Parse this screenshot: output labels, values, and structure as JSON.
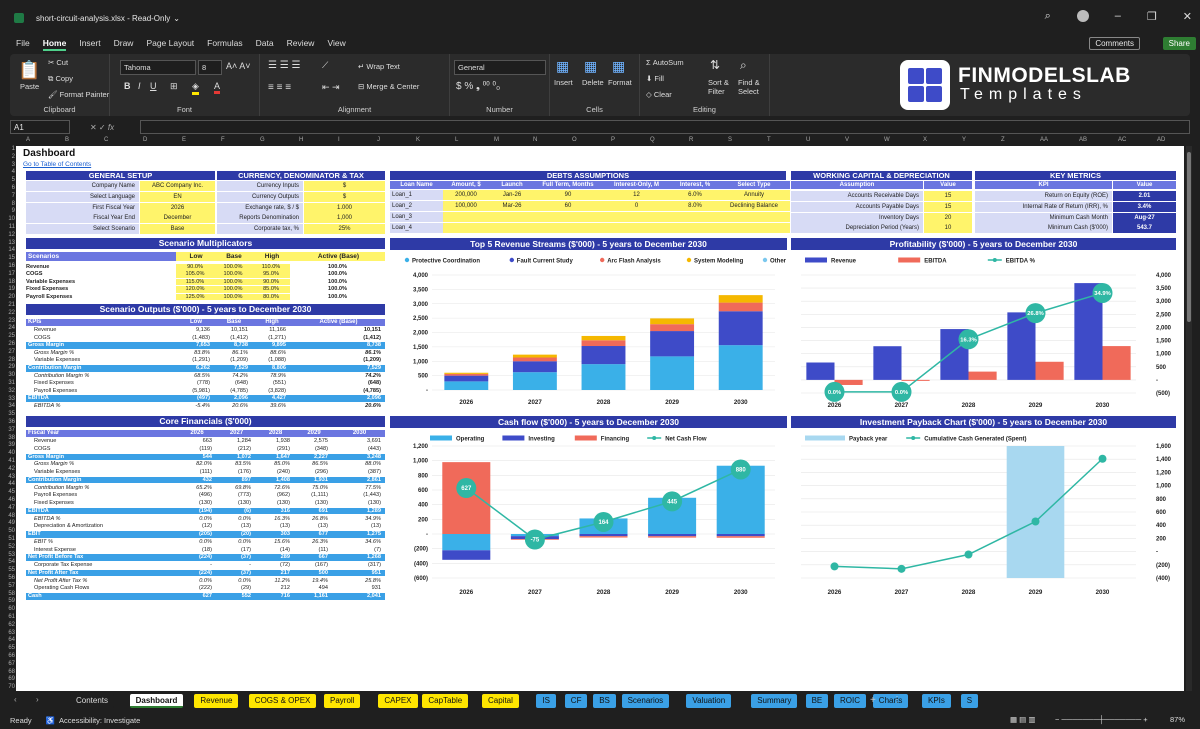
{
  "window": {
    "title": "short-circuit-analysis.xlsx - Read-Only",
    "chev": "⌄"
  },
  "menu": [
    "File",
    "Home",
    "Insert",
    "Draw",
    "Page Layout",
    "Formulas",
    "Data",
    "Review",
    "View"
  ],
  "menu_selected": "Home",
  "top_buttons": {
    "comments": "Comments",
    "share": "Share"
  },
  "ribbon": {
    "clipboard": {
      "paste": "Paste",
      "cut": "Cut",
      "copy": "Copy",
      "format_painter": "Format Painter",
      "label": "Clipboard"
    },
    "font": {
      "name": "Tahoma",
      "size": "8",
      "label": "Font"
    },
    "alignment": {
      "wrap": "Wrap Text",
      "merge": "Merge & Center",
      "label": "Alignment"
    },
    "number": {
      "format": "General",
      "label": "Number"
    },
    "cells": {
      "insert": "Insert",
      "delete": "Delete",
      "format": "Format",
      "label": "Cells"
    },
    "editing": {
      "autosum": "AutoSum",
      "fill": "Fill",
      "clear": "Clear",
      "sort": "Sort & Filter",
      "find": "Find & Select",
      "label": "Editing"
    }
  },
  "logo": {
    "line1": "FINMODELSLAB",
    "line2": "Templates"
  },
  "formula_bar": {
    "name_box": "A1",
    "fx": "fx"
  },
  "columns": [
    "A",
    "B",
    "C",
    "D",
    "E",
    "F",
    "G",
    "H",
    "I",
    "J",
    "K",
    "L",
    "M",
    "N",
    "O",
    "P",
    "Q",
    "R",
    "S",
    "T",
    "U",
    "V",
    "W",
    "X",
    "Y",
    "Z",
    "AA",
    "AB",
    "AC",
    "AD"
  ],
  "sheet": {
    "title": "Dashboard",
    "toc_link": "Go to Table of Contents",
    "general_setup": {
      "header": "GENERAL SETUP",
      "rows": [
        [
          "Company Name",
          "ABC Company Inc."
        ],
        [
          "Select Language",
          "EN"
        ],
        [
          "First Fiscal Year",
          "2026"
        ],
        [
          "Fiscal Year End",
          "December"
        ],
        [
          "Select Scenario",
          "Base"
        ]
      ]
    },
    "currency": {
      "header": "CURRENCY, DENOMINATOR & TAX",
      "rows": [
        [
          "Currency Inputs",
          "$"
        ],
        [
          "Currency Outputs",
          "$"
        ],
        [
          "Exchange rate, $ / $",
          "1.000"
        ],
        [
          "Reports Denomination",
          "1,000"
        ],
        [
          "Corporate tax, %",
          "25%"
        ]
      ]
    },
    "debts": {
      "header": "DEBTS ASSUMPTIONS",
      "cols": [
        "Loan Name",
        "Amount, $",
        "Launch",
        "Full Term, Months",
        "Interest-Only, M",
        "Interest, %",
        "Select Type"
      ],
      "rows": [
        [
          "Loan_1",
          "200,000",
          "Jan-26",
          "90",
          "12",
          "6.0%",
          "Annuity"
        ],
        [
          "Loan_2",
          "100,000",
          "Mar-26",
          "60",
          "0",
          "8.0%",
          "Declining Balance"
        ],
        [
          "Loan_3",
          "",
          "",
          "",
          "",
          "",
          ""
        ],
        [
          "Loan_4",
          "",
          "",
          "",
          "",
          "",
          ""
        ]
      ]
    },
    "wc": {
      "header": "WORKING CAPITAL & DEPRECIATION",
      "cols": [
        "Assumption",
        "Value"
      ],
      "rows": [
        [
          "Accounts Receivable Days",
          "15"
        ],
        [
          "Accounts Payable Days",
          "15"
        ],
        [
          "Inventory Days",
          "20"
        ],
        [
          "Depreciation Period (Years)",
          "10"
        ]
      ]
    },
    "kpi": {
      "header": "KEY METRICS",
      "cols": [
        "KPI",
        "Value"
      ],
      "rows": [
        [
          "Return on Equity (ROE)",
          "2.01"
        ],
        [
          "Internal Rate of Return (IRR), %",
          "3.4%"
        ],
        [
          "Minimum Cash Month",
          "Aug-27"
        ],
        [
          "Minimum Cash ($'000)",
          "543.7"
        ]
      ]
    },
    "scen_mult": {
      "title": "Scenario Multiplicators",
      "cols": [
        "Scenarios",
        "Low",
        "Base",
        "High",
        "Active (Base)"
      ],
      "rows": [
        [
          "Revenue",
          "90.0%",
          "100.0%",
          "110.0%",
          "100.0%"
        ],
        [
          "COGS",
          "105.0%",
          "100.0%",
          "95.0%",
          "100.0%"
        ],
        [
          "Variable Expenses",
          "115.0%",
          "100.0%",
          "90.0%",
          "100.0%"
        ],
        [
          "Fixed Expenses",
          "120.0%",
          "100.0%",
          "85.0%",
          "100.0%"
        ],
        [
          "Payroll Expenses",
          "125.0%",
          "100.0%",
          "80.0%",
          "100.0%"
        ]
      ]
    },
    "scen_out": {
      "title": "Scenario Outputs ($'000) - 5 years to December 2030",
      "cols": [
        "KPIs",
        "Low",
        "Base",
        "High",
        "Active (Base)"
      ],
      "rows": [
        [
          "Revenue",
          "9,136",
          "10,151",
          "11,166",
          "10,151",
          "n"
        ],
        [
          "COGS",
          "(1,483)",
          "(1,412)",
          "(1,271)",
          "(1,412)",
          "n"
        ],
        [
          "Gross Margin",
          "7,653",
          "8,738",
          "9,895",
          "8,738",
          "h"
        ],
        [
          "Gross Margin %",
          "83.8%",
          "86.1%",
          "88.6%",
          "86.1%",
          "i"
        ],
        [
          "Variable Expenses",
          "(1,291)",
          "(1,209)",
          "(1,088)",
          "(1,209)",
          "n"
        ],
        [
          "Contribution Margin",
          "6,262",
          "7,529",
          "8,806",
          "7,529",
          "h"
        ],
        [
          "Contribution Margin %",
          "68.5%",
          "74.2%",
          "78.9%",
          "74.2%",
          "i"
        ],
        [
          "Fixed Expenses",
          "(778)",
          "(648)",
          "(551)",
          "(648)",
          "n"
        ],
        [
          "Payroll Expenses",
          "(5,981)",
          "(4,785)",
          "(3,828)",
          "(4,785)",
          "n"
        ],
        [
          "EBITDA",
          "(497)",
          "2,096",
          "4,427",
          "2,096",
          "h"
        ],
        [
          "EBITDA %",
          "-5.4%",
          "20.6%",
          "39.6%",
          "20.6%",
          "i"
        ]
      ]
    },
    "core": {
      "title": "Core Financials ($'000)",
      "cols": [
        "Fiscal Year",
        "2026",
        "2027",
        "2028",
        "2029",
        "2030"
      ],
      "rows": [
        [
          "Revenue",
          "663",
          "1,284",
          "1,938",
          "2,575",
          "3,691",
          "n"
        ],
        [
          "COGS",
          "(119)",
          "(212)",
          "(291)",
          "(348)",
          "(443)",
          "n"
        ],
        [
          "Gross Margin",
          "544",
          "1,072",
          "1,647",
          "2,227",
          "3,248",
          "h"
        ],
        [
          "Gross Margin %",
          "82.0%",
          "83.5%",
          "85.0%",
          "86.5%",
          "88.0%",
          "i"
        ],
        [
          "Variable Expenses",
          "(111)",
          "(176)",
          "(240)",
          "(296)",
          "(387)",
          "n"
        ],
        [
          "Contribution Margin",
          "432",
          "897",
          "1,408",
          "1,931",
          "2,861",
          "h"
        ],
        [
          "Contribution Margin %",
          "65.2%",
          "69.8%",
          "72.6%",
          "75.0%",
          "77.5%",
          "i"
        ],
        [
          "Payroll Expenses",
          "(496)",
          "(773)",
          "(962)",
          "(1,111)",
          "(1,443)",
          "n"
        ],
        [
          "Fixed Expenses",
          "(130)",
          "(130)",
          "(130)",
          "(130)",
          "(130)",
          "n"
        ],
        [
          "EBITDA",
          "(194)",
          "(6)",
          "316",
          "691",
          "1,289",
          "h"
        ],
        [
          "EBITDA %",
          "0.0%",
          "0.0%",
          "16.3%",
          "26.8%",
          "34.9%",
          "i"
        ],
        [
          "Depreciation & Amortization",
          "(12)",
          "(13)",
          "(13)",
          "(13)",
          "(13)",
          "n"
        ],
        [
          "EBIT",
          "(205)",
          "(20)",
          "303",
          "677",
          "1,275",
          "h"
        ],
        [
          "EBIT %",
          "0.0%",
          "0.0%",
          "15.6%",
          "26.3%",
          "34.6%",
          "i"
        ],
        [
          "Interest Expense",
          "(18)",
          "(17)",
          "(14)",
          "(11)",
          "(7)",
          "n"
        ],
        [
          "Net Profit Before Tax",
          "(224)",
          "(37)",
          "289",
          "667",
          "1,268",
          "h"
        ],
        [
          "Corporate Tax Expense",
          "-",
          "-",
          "(72)",
          "(167)",
          "(317)",
          "n"
        ],
        [
          "Net Profit After Tax",
          "(224)",
          "(37)",
          "217",
          "500",
          "951",
          "h"
        ],
        [
          "Net Profit After Tax %",
          "0.0%",
          "0.0%",
          "11.2%",
          "19.4%",
          "25.8%",
          "i"
        ],
        [
          "Operating Cash Flows",
          "(222)",
          "(29)",
          "212",
          "494",
          "931",
          "n"
        ],
        [
          "Cash",
          "627",
          "552",
          "716",
          "1,161",
          "2,041",
          "h"
        ]
      ]
    }
  },
  "tabs": [
    {
      "label": "Contents",
      "color": "#1f1f1f",
      "fg": "#ddd"
    },
    {
      "label": "Dashboard",
      "color": "#ffffff",
      "fg": "#111"
    },
    {
      "label": "Revenue",
      "color": "#ffe600",
      "fg": "#111"
    },
    {
      "label": "COGS & OPEX",
      "color": "#ffe600",
      "fg": "#111"
    },
    {
      "label": "Payroll",
      "color": "#ffe600",
      "fg": "#111"
    },
    {
      "label": "CAPEX",
      "color": "#ffe600",
      "fg": "#111"
    },
    {
      "label": "CapTable",
      "color": "#ffe600",
      "fg": "#111"
    },
    {
      "label": "Capital",
      "color": "#ffe600",
      "fg": "#111"
    },
    {
      "label": "IS",
      "color": "#3aa0e6",
      "fg": "#111"
    },
    {
      "label": "CF",
      "color": "#3aa0e6",
      "fg": "#111"
    },
    {
      "label": "BS",
      "color": "#3aa0e6",
      "fg": "#111"
    },
    {
      "label": "Scenarios",
      "color": "#3aa0e6",
      "fg": "#111"
    },
    {
      "label": "Valuation",
      "color": "#3aa0e6",
      "fg": "#111"
    },
    {
      "label": "Summary",
      "color": "#3aa0e6",
      "fg": "#111"
    },
    {
      "label": "BE",
      "color": "#3aa0e6",
      "fg": "#111"
    },
    {
      "label": "ROIC",
      "color": "#3aa0e6",
      "fg": "#111"
    },
    {
      "label": "Charts",
      "color": "#3aa0e6",
      "fg": "#111"
    },
    {
      "label": "KPIs",
      "color": "#3aa0e6",
      "fg": "#111"
    },
    {
      "label": "S",
      "color": "#3aa0e6",
      "fg": "#111"
    }
  ],
  "status": {
    "ready": "Ready",
    "accessibility": "Accessibility: Investigate",
    "zoom": "87%"
  },
  "chart_data": [
    {
      "type": "bar",
      "title": "Top 5 Revenue Streams ($'000) - 5 years to December 2030",
      "stacked": true,
      "categories": [
        "2026",
        "2027",
        "2028",
        "2029",
        "2030"
      ],
      "series": [
        {
          "name": "Protective Coordination",
          "color": "#3ab0e8",
          "values": [
            300,
            620,
            900,
            1170,
            1560
          ]
        },
        {
          "name": "Fault Current Study",
          "color": "#3e4bc8",
          "values": [
            200,
            380,
            630,
            880,
            1180
          ]
        },
        {
          "name": "Arc Flash Analysis",
          "color": "#f06a5a",
          "values": [
            60,
            130,
            200,
            240,
            300
          ]
        },
        {
          "name": "System Modeling",
          "color": "#f5b800",
          "values": [
            40,
            100,
            150,
            200,
            260
          ]
        },
        {
          "name": "Other Revenue",
          "color": "#7bc8ee",
          "values": [
            0,
            0,
            0,
            0,
            0
          ]
        }
      ],
      "ylim": [
        0,
        4000
      ],
      "yticks": [
        "-",
        "500",
        "1,000",
        "1,500",
        "2,000",
        "2,500",
        "3,000",
        "3,500",
        "4,000"
      ]
    },
    {
      "type": "bar",
      "title": "Profitability ($'000) - 5 years to December 2030",
      "categories": [
        "2026",
        "2027",
        "2028",
        "2029",
        "2030"
      ],
      "series": [
        {
          "name": "Revenue",
          "color": "#3e4bc8",
          "values": [
            663,
            1284,
            1938,
            2575,
            3691
          ]
        },
        {
          "name": "EBITDA",
          "color": "#f06a5a",
          "values": [
            -194,
            -6,
            316,
            691,
            1289
          ]
        },
        {
          "name": "EBITDA %",
          "color": "#2fb7a4",
          "values": [
            0.0,
            0.0,
            16.3,
            26.8,
            34.9
          ],
          "labels": [
            "0.0%",
            "0.0%",
            "16.3%",
            "26.8%",
            "34.9%"
          ]
        }
      ],
      "ylim": [
        -500,
        4000
      ],
      "yticks": [
        "(500)",
        "-",
        "500",
        "1,000",
        "1,500",
        "2,000",
        "2,500",
        "3,000",
        "3,500",
        "4,000"
      ]
    },
    {
      "type": "bar",
      "title": "Cash flow ($'000) - 5 years to December 2030",
      "categories": [
        "2026",
        "2027",
        "2028",
        "2029",
        "2030"
      ],
      "series": [
        {
          "name": "Operating",
          "color": "#3ab0e8",
          "values": [
            -222,
            -29,
            212,
            494,
            931
          ]
        },
        {
          "name": "Investing",
          "color": "#3e4bc8",
          "values": [
            -130,
            -40,
            -30,
            -30,
            -30
          ]
        },
        {
          "name": "Financing",
          "color": "#f06a5a",
          "values": [
            980,
            -10,
            -18,
            -19,
            -21
          ]
        },
        {
          "name": "Net Cash Flow",
          "color": "#2fb7a4",
          "values": [
            627,
            -75,
            164,
            445,
            880
          ],
          "labels": [
            "627",
            "-75",
            "164",
            "445",
            "880"
          ]
        }
      ],
      "ylim": [
        -600,
        1200
      ],
      "yticks": [
        "(600)",
        "(400)",
        "(200)",
        "-",
        "200",
        "400",
        "600",
        "800",
        "1,000",
        "1,200"
      ]
    },
    {
      "type": "bar",
      "title": "Investment Payback Chart ($'000) - 5 years to December 2030",
      "categories": [
        "2026",
        "2027",
        "2028",
        "2029",
        "2030"
      ],
      "series": [
        {
          "name": "Payback year",
          "color": "#a8d8f0",
          "values": [
            0,
            0,
            0,
            1,
            0
          ]
        },
        {
          "name": "Cumulative Cash Generated (Spent)",
          "color": "#2fb7a4",
          "values": [
            -224,
            -261,
            -44,
            456,
            1407
          ]
        }
      ],
      "ylim": [
        -400,
        1600
      ],
      "yticks": [
        "(400)",
        "(200)",
        "-",
        "200",
        "400",
        "600",
        "800",
        "1,000",
        "1,200",
        "1,400",
        "1,600"
      ]
    }
  ]
}
